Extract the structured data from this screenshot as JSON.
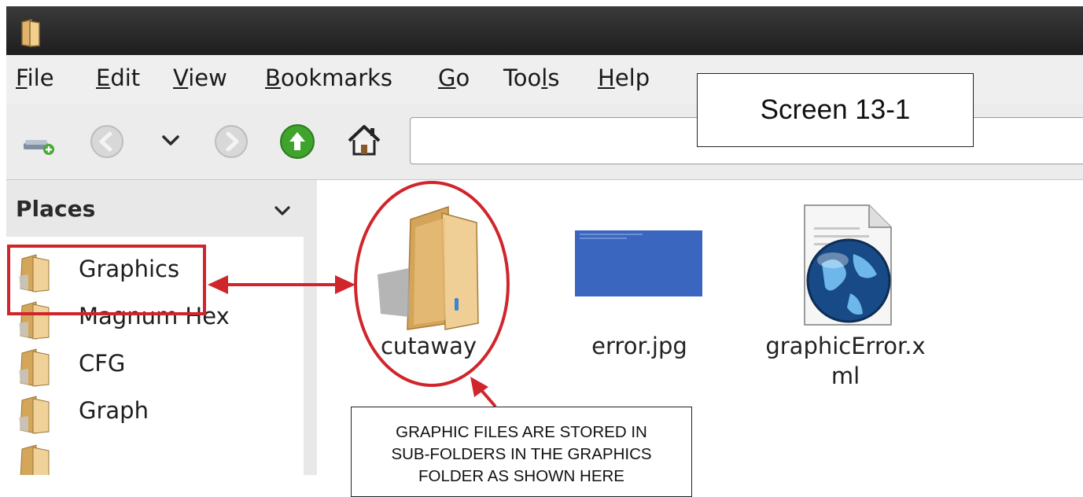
{
  "menu": {
    "file": {
      "mnemonic": "F",
      "rest": "ile"
    },
    "edit": {
      "mnemonic": "E",
      "rest": "dit"
    },
    "view": {
      "mnemonic": "V",
      "rest": "iew"
    },
    "bookmarks": {
      "mnemonic": "B",
      "rest": "ookmarks"
    },
    "go": {
      "mnemonic": "G",
      "rest": "o"
    },
    "tools": {
      "pre": "Too",
      "mnemonic": "l",
      "rest": "s"
    },
    "help": {
      "mnemonic": "H",
      "rest": "elp"
    }
  },
  "screen_label": "Screen 13-1",
  "sidebar": {
    "header": "Places",
    "items": [
      {
        "label": "Graphics"
      },
      {
        "label": "Magnum Hex"
      },
      {
        "label": "CFG"
      },
      {
        "label": "Graph"
      }
    ]
  },
  "files": [
    {
      "name": "cutaway",
      "type": "folder"
    },
    {
      "name": "error.jpg",
      "type": "image"
    },
    {
      "name_line1": "graphicError.x",
      "name_line2": "ml",
      "type": "xml"
    }
  ],
  "callout": {
    "line1": "GRAPHIC FILES ARE STORED IN",
    "line2": "SUB-FOLDERS IN THE GRAPHICS",
    "line3": "FOLDER AS SHOWN HERE"
  },
  "colors": {
    "annotation_red": "#d0252b",
    "folder_tan": "#e7c48a",
    "image_blue": "#3a66c0"
  },
  "icons": [
    "folder-icon",
    "add-location-icon",
    "back-icon",
    "chevron-down-icon",
    "forward-icon",
    "up-icon",
    "home-icon",
    "globe-document-icon"
  ]
}
